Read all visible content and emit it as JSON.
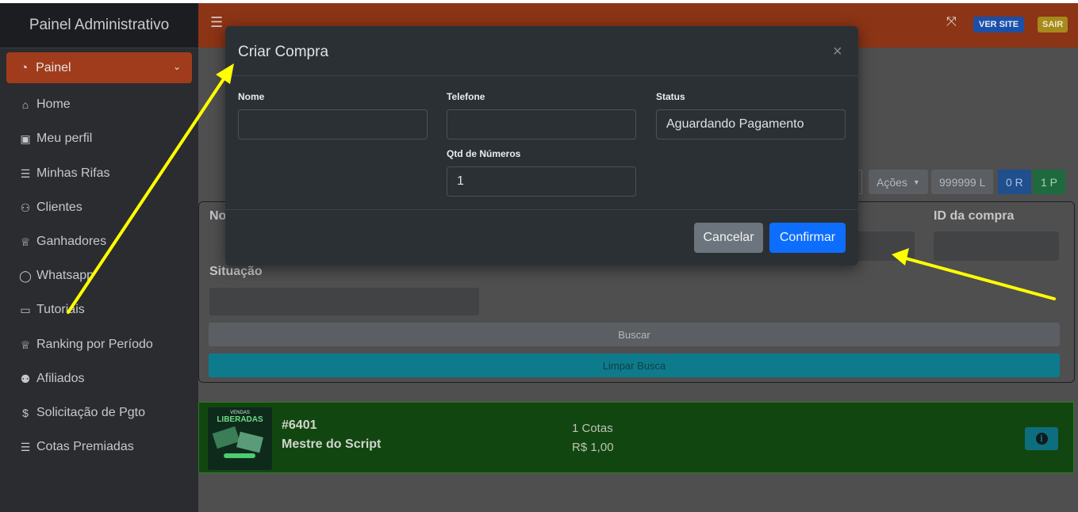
{
  "sidebar": {
    "brand": "Painel Administrativo",
    "active_item": {
      "label": "Painel",
      "icon": "dashboard-gauge-icon"
    },
    "items": [
      {
        "label": "Home",
        "icon": "home-icon"
      },
      {
        "label": "Meu perfil",
        "icon": "id-badge-icon"
      },
      {
        "label": "Minhas Rifas",
        "icon": "list-box-icon"
      },
      {
        "label": "Clientes",
        "icon": "users-icon"
      },
      {
        "label": "Ganhadores",
        "icon": "trophy-icon"
      },
      {
        "label": "Whatsapp",
        "icon": "whatsapp-icon"
      },
      {
        "label": "Tutoriais",
        "icon": "video-camera-icon"
      },
      {
        "label": "Ranking por Período",
        "icon": "trophy-icon"
      },
      {
        "label": "Afiliados",
        "icon": "user-plus-icon"
      },
      {
        "label": "Solicitação de Pgto",
        "icon": "dollar-icon"
      },
      {
        "label": "Cotas Premiadas",
        "icon": "list-box-icon"
      }
    ]
  },
  "topbar": {
    "ver_site": "VER SITE",
    "sair": "SAIR"
  },
  "controls": {
    "acoes": "Ações",
    "badge_l": "999999 L",
    "badge_r": "0 R",
    "badge_p": "1 P"
  },
  "filter": {
    "label_nome_partial": "No",
    "label_id_compra": "ID da compra",
    "label_situacao": "Situação",
    "buscar": "Buscar",
    "limpar": "Limpar Busca"
  },
  "card": {
    "thumb_line1": "VENDAS",
    "thumb_line2": "LIBERADAS",
    "order_id": "#6401",
    "name": "Mestre do Script",
    "cotas": "1 Cotas",
    "price": "R$ 1,00"
  },
  "modal": {
    "title": "Criar Compra",
    "close": "×",
    "fields": {
      "nome": {
        "label": "Nome",
        "value": ""
      },
      "telefone": {
        "label": "Telefone",
        "value": ""
      },
      "status": {
        "label": "Status",
        "value": "Aguardando Pagamento"
      },
      "qtd": {
        "label": "Qtd de Números",
        "value": "1"
      }
    },
    "cancel": "Cancelar",
    "confirm": "Confirmar"
  },
  "colors": {
    "topbar": "#8c3416",
    "active_nav": "#a03c1c",
    "confirm": "#0d6efd",
    "annotation_arrow": "#ffff00"
  }
}
